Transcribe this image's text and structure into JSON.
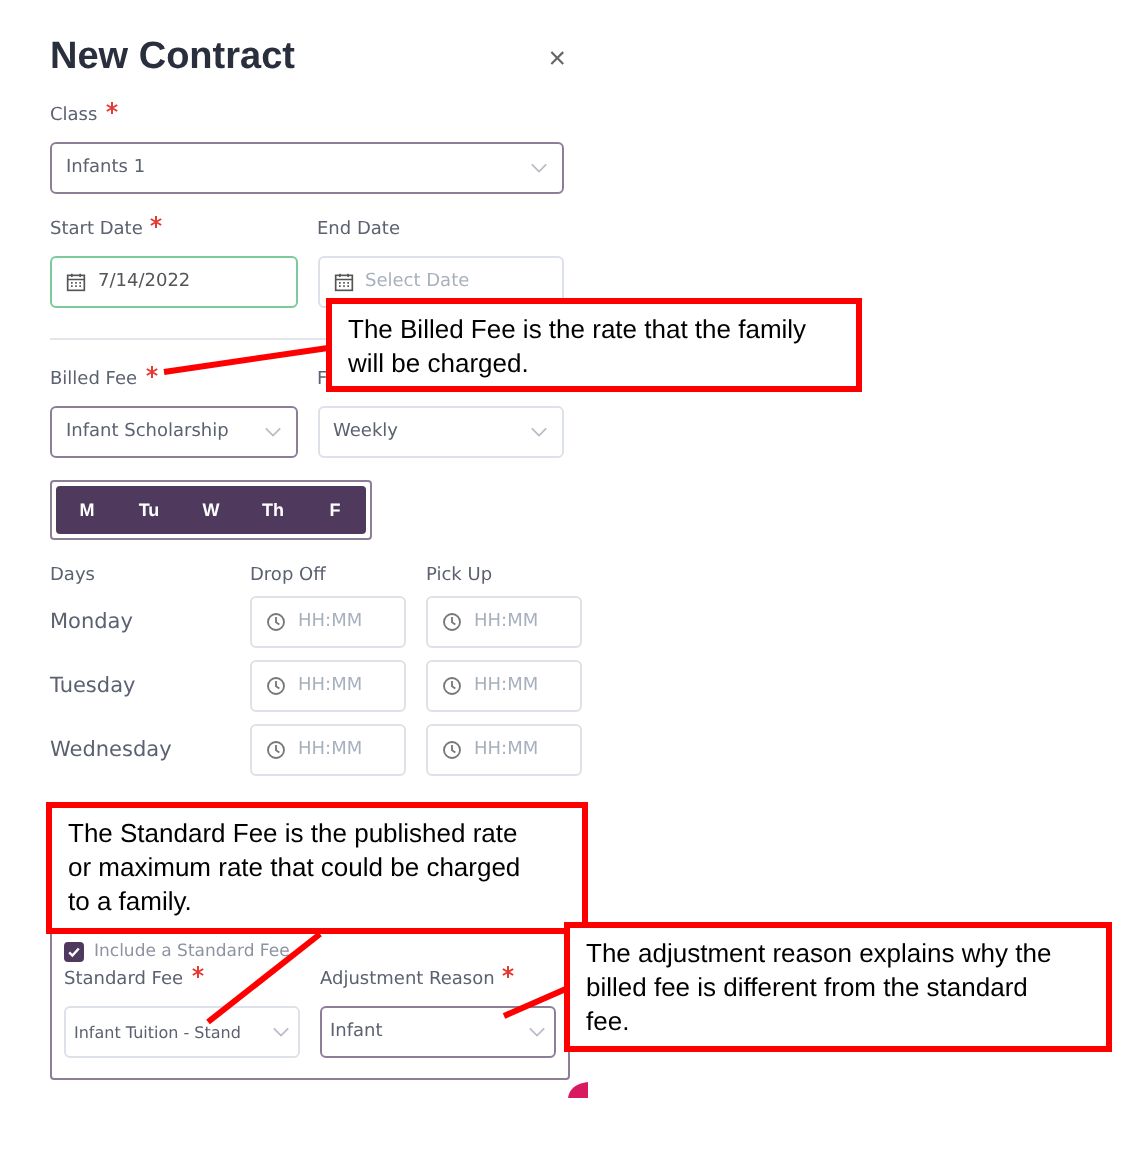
{
  "dialog": {
    "title": "New Contract",
    "close": "×"
  },
  "class_field": {
    "label": "Class",
    "required": true,
    "value": "Infants 1"
  },
  "start_date": {
    "label": "Start Date",
    "required": true,
    "value": "7/14/2022"
  },
  "end_date": {
    "label": "End Date",
    "placeholder": "Select Date"
  },
  "billed_fee": {
    "label": "Billed Fee",
    "required": true,
    "value": "Infant Scholarship"
  },
  "frequency": {
    "label": "F",
    "value": "Weekly"
  },
  "weekdays": [
    {
      "label": "M",
      "selected": true
    },
    {
      "label": "Tu",
      "selected": true
    },
    {
      "label": "W",
      "selected": true
    },
    {
      "label": "Th",
      "selected": true
    },
    {
      "label": "F",
      "selected": true
    }
  ],
  "schedule": {
    "columns": [
      "Days",
      "Drop Off",
      "Pick Up"
    ],
    "rows": [
      {
        "day": "Monday",
        "drop_off": {
          "placeholder": "HH:MM"
        },
        "pick_up": {
          "placeholder": "HH:MM"
        }
      },
      {
        "day": "Tuesday",
        "drop_off": {
          "placeholder": "HH:MM"
        },
        "pick_up": {
          "placeholder": "HH:MM"
        }
      },
      {
        "day": "Wednesday",
        "drop_off": {
          "placeholder": "HH:MM"
        },
        "pick_up": {
          "placeholder": "HH:MM"
        }
      }
    ]
  },
  "standard_fee_panel": {
    "checkbox": {
      "label": "Include a Standard Fee",
      "checked": true
    },
    "standard_fee": {
      "label": "Standard Fee",
      "required": true,
      "value": "Infant Tuition - Stand"
    },
    "adjustment_reason": {
      "label": "Adjustment Reason",
      "required": true,
      "value": "Infant"
    }
  },
  "callouts": [
    {
      "text": "The Billed Fee is the rate that the family will be charged."
    },
    {
      "text": "The Standard Fee is the published rate or maximum rate that could be charged to a family."
    },
    {
      "text": "The adjustment reason explains why the billed fee is different from the standard fee."
    }
  ]
}
